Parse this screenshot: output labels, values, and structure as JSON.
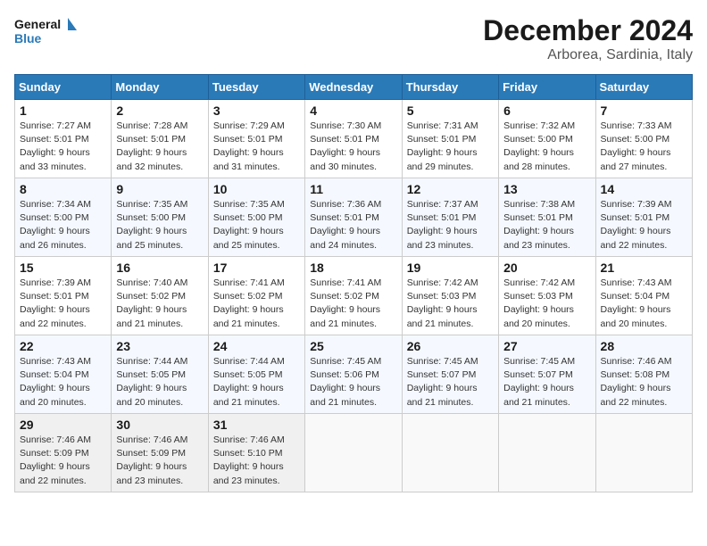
{
  "header": {
    "logo_line1": "General",
    "logo_line2": "Blue",
    "month": "December 2024",
    "location": "Arborea, Sardinia, Italy"
  },
  "days_of_week": [
    "Sunday",
    "Monday",
    "Tuesday",
    "Wednesday",
    "Thursday",
    "Friday",
    "Saturday"
  ],
  "weeks": [
    [
      {
        "day": 1,
        "sunrise": "7:27 AM",
        "sunset": "5:01 PM",
        "daylight": "9 hours and 33 minutes."
      },
      {
        "day": 2,
        "sunrise": "7:28 AM",
        "sunset": "5:01 PM",
        "daylight": "9 hours and 32 minutes."
      },
      {
        "day": 3,
        "sunrise": "7:29 AM",
        "sunset": "5:01 PM",
        "daylight": "9 hours and 31 minutes."
      },
      {
        "day": 4,
        "sunrise": "7:30 AM",
        "sunset": "5:01 PM",
        "daylight": "9 hours and 30 minutes."
      },
      {
        "day": 5,
        "sunrise": "7:31 AM",
        "sunset": "5:01 PM",
        "daylight": "9 hours and 29 minutes."
      },
      {
        "day": 6,
        "sunrise": "7:32 AM",
        "sunset": "5:00 PM",
        "daylight": "9 hours and 28 minutes."
      },
      {
        "day": 7,
        "sunrise": "7:33 AM",
        "sunset": "5:00 PM",
        "daylight": "9 hours and 27 minutes."
      }
    ],
    [
      {
        "day": 8,
        "sunrise": "7:34 AM",
        "sunset": "5:00 PM",
        "daylight": "9 hours and 26 minutes."
      },
      {
        "day": 9,
        "sunrise": "7:35 AM",
        "sunset": "5:00 PM",
        "daylight": "9 hours and 25 minutes."
      },
      {
        "day": 10,
        "sunrise": "7:35 AM",
        "sunset": "5:00 PM",
        "daylight": "9 hours and 25 minutes."
      },
      {
        "day": 11,
        "sunrise": "7:36 AM",
        "sunset": "5:01 PM",
        "daylight": "9 hours and 24 minutes."
      },
      {
        "day": 12,
        "sunrise": "7:37 AM",
        "sunset": "5:01 PM",
        "daylight": "9 hours and 23 minutes."
      },
      {
        "day": 13,
        "sunrise": "7:38 AM",
        "sunset": "5:01 PM",
        "daylight": "9 hours and 23 minutes."
      },
      {
        "day": 14,
        "sunrise": "7:39 AM",
        "sunset": "5:01 PM",
        "daylight": "9 hours and 22 minutes."
      }
    ],
    [
      {
        "day": 15,
        "sunrise": "7:39 AM",
        "sunset": "5:01 PM",
        "daylight": "9 hours and 22 minutes."
      },
      {
        "day": 16,
        "sunrise": "7:40 AM",
        "sunset": "5:02 PM",
        "daylight": "9 hours and 21 minutes."
      },
      {
        "day": 17,
        "sunrise": "7:41 AM",
        "sunset": "5:02 PM",
        "daylight": "9 hours and 21 minutes."
      },
      {
        "day": 18,
        "sunrise": "7:41 AM",
        "sunset": "5:02 PM",
        "daylight": "9 hours and 21 minutes."
      },
      {
        "day": 19,
        "sunrise": "7:42 AM",
        "sunset": "5:03 PM",
        "daylight": "9 hours and 21 minutes."
      },
      {
        "day": 20,
        "sunrise": "7:42 AM",
        "sunset": "5:03 PM",
        "daylight": "9 hours and 20 minutes."
      },
      {
        "day": 21,
        "sunrise": "7:43 AM",
        "sunset": "5:04 PM",
        "daylight": "9 hours and 20 minutes."
      }
    ],
    [
      {
        "day": 22,
        "sunrise": "7:43 AM",
        "sunset": "5:04 PM",
        "daylight": "9 hours and 20 minutes."
      },
      {
        "day": 23,
        "sunrise": "7:44 AM",
        "sunset": "5:05 PM",
        "daylight": "9 hours and 20 minutes."
      },
      {
        "day": 24,
        "sunrise": "7:44 AM",
        "sunset": "5:05 PM",
        "daylight": "9 hours and 21 minutes."
      },
      {
        "day": 25,
        "sunrise": "7:45 AM",
        "sunset": "5:06 PM",
        "daylight": "9 hours and 21 minutes."
      },
      {
        "day": 26,
        "sunrise": "7:45 AM",
        "sunset": "5:07 PM",
        "daylight": "9 hours and 21 minutes."
      },
      {
        "day": 27,
        "sunrise": "7:45 AM",
        "sunset": "5:07 PM",
        "daylight": "9 hours and 21 minutes."
      },
      {
        "day": 28,
        "sunrise": "7:46 AM",
        "sunset": "5:08 PM",
        "daylight": "9 hours and 22 minutes."
      }
    ],
    [
      {
        "day": 29,
        "sunrise": "7:46 AM",
        "sunset": "5:09 PM",
        "daylight": "9 hours and 22 minutes."
      },
      {
        "day": 30,
        "sunrise": "7:46 AM",
        "sunset": "5:09 PM",
        "daylight": "9 hours and 23 minutes."
      },
      {
        "day": 31,
        "sunrise": "7:46 AM",
        "sunset": "5:10 PM",
        "daylight": "9 hours and 23 minutes."
      },
      null,
      null,
      null,
      null
    ]
  ]
}
